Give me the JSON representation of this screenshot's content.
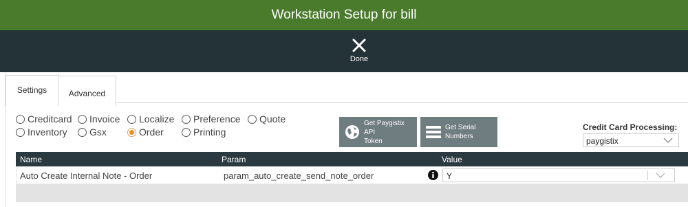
{
  "window": {
    "title": "Workstation Setup for bill"
  },
  "toolbar": {
    "done_label": "Done"
  },
  "tabs": [
    {
      "label": "Settings",
      "active": true
    },
    {
      "label": "Advanced",
      "active": false
    }
  ],
  "categories": [
    {
      "label": "Creditcard",
      "checked": false
    },
    {
      "label": "Invoice",
      "checked": false
    },
    {
      "label": "Localize",
      "checked": false
    },
    {
      "label": "Preference",
      "checked": false
    },
    {
      "label": "Quote",
      "checked": false
    },
    {
      "label": "Inventory",
      "checked": false
    },
    {
      "label": "Gsx",
      "checked": false
    },
    {
      "label": "Order",
      "checked": true
    },
    {
      "label": "Printing",
      "checked": false
    }
  ],
  "actions": {
    "paygistix_token_label_line1": "Get Paygistix API",
    "paygistix_token_label_line2": "Token",
    "serial_numbers_label_line1": "Get Serial",
    "serial_numbers_label_line2": "Numbers"
  },
  "credit_card_processing": {
    "label": "Credit Card Processing:",
    "selected": "paygistix"
  },
  "table": {
    "columns": [
      "Name",
      "Param",
      "Value"
    ],
    "rows": [
      {
        "name": "Auto Create Internal Note - Order",
        "param": "param_auto_create_send_note_order",
        "value": "Y"
      }
    ]
  },
  "colors": {
    "title_bar": "#4a7a2c",
    "toolbar": "#243338",
    "grid_header": "#2b3a40",
    "accent_radio": "#f08a24",
    "action_button": "#6f7c80"
  }
}
